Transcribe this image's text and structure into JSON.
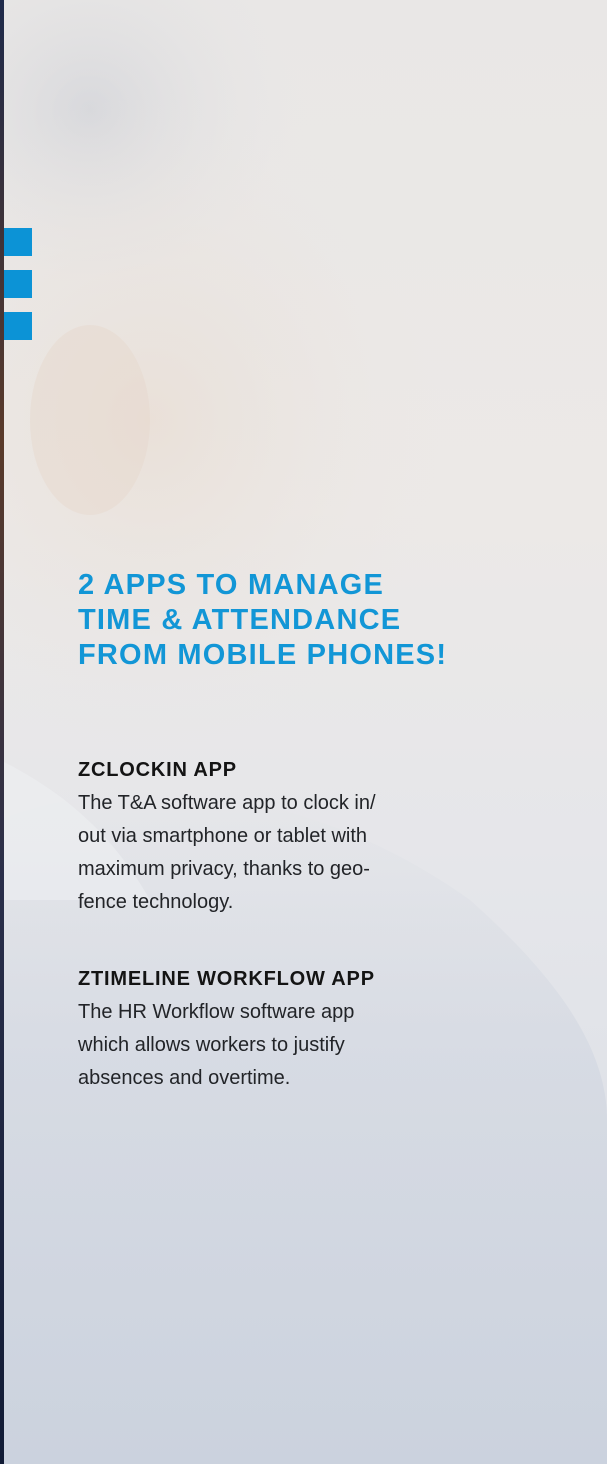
{
  "headline": {
    "lines": [
      "2 APPS TO MANAGE",
      "TIME & ATTENDANCE",
      "FROM MOBILE PHONES!"
    ]
  },
  "sections": [
    {
      "title": "ZCLOCKIN APP",
      "lines": [
        "The T&A software app to clock in/",
        "out via smartphone or tablet with",
        "maximum privacy, thanks to geo-",
        "fence technology."
      ]
    },
    {
      "title": "ZTIMELINE WORKFLOW APP",
      "lines": [
        "The HR Workflow software app",
        "which allows workers to justify",
        "absences and overtime."
      ]
    }
  ],
  "colors": {
    "accent": "#1296d6",
    "square": "#0c93d6",
    "text": "#222428"
  }
}
